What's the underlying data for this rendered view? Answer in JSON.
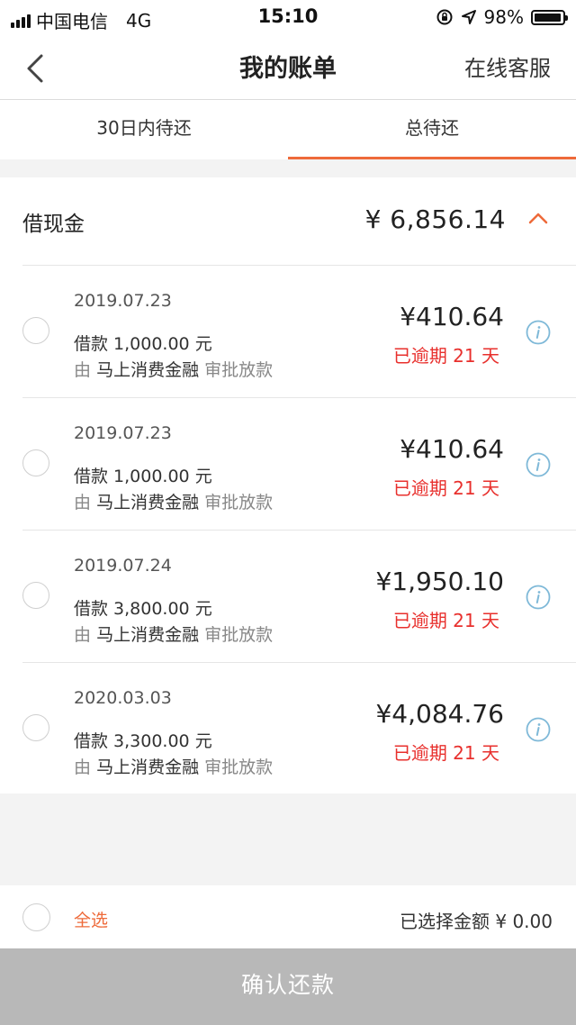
{
  "status_bar": {
    "carrier": "中国电信",
    "network": "4G",
    "time": "15:10",
    "battery_text": "98%",
    "battery_level": 0.98,
    "icons": [
      "signal-icon",
      "rotation-lock-icon",
      "location-arrow-icon",
      "battery-icon"
    ]
  },
  "nav": {
    "back_icon": "chevron-left-icon",
    "title": "我的账单",
    "right_label": "在线客服"
  },
  "tabs": [
    {
      "label": "30日内待还",
      "active": false
    },
    {
      "label": "总待还",
      "active": true
    }
  ],
  "section": {
    "title": "借现金",
    "amount": "¥ 6,856.14",
    "toggle_icon": "chevron-up-icon"
  },
  "bills": [
    {
      "date": "2019.07.23",
      "loan": "借款 1,000.00 元",
      "by": "由",
      "lender": "马上消费金融",
      "action": "审批放款",
      "amount": "¥410.64",
      "status": "已逾期 21 天"
    },
    {
      "date": "2019.07.23",
      "loan": "借款 1,000.00 元",
      "by": "由",
      "lender": "马上消费金融",
      "action": "审批放款",
      "amount": "¥410.64",
      "status": "已逾期 21 天"
    },
    {
      "date": "2019.07.24",
      "loan": "借款 3,800.00 元",
      "by": "由",
      "lender": "马上消费金融",
      "action": "审批放款",
      "amount": "¥1,950.10",
      "status": "已逾期 21 天"
    },
    {
      "date": "2020.03.03",
      "loan": "借款 3,300.00 元",
      "by": "由",
      "lender": "马上消费金融",
      "action": "审批放款",
      "amount": "¥4,084.76",
      "status": "已逾期 21 天"
    }
  ],
  "footer": {
    "select_all": "全选",
    "selected_total": "已选择金额 ¥ 0.00",
    "confirm_label": "确认还款"
  },
  "colors": {
    "accent": "#ee6a3a",
    "overdue": "#e8302d",
    "info_icon": "#7fb9d8",
    "disabled_button": "#b8b8b8"
  }
}
